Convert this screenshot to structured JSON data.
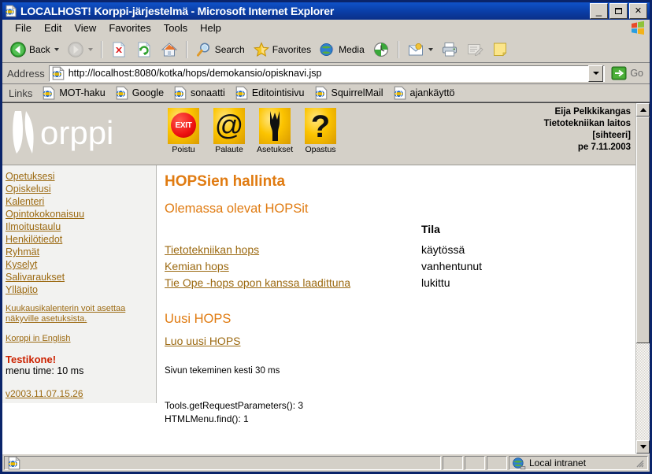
{
  "window": {
    "title": "LOCALHOST! Korppi-järjestelmä - Microsoft Internet Explorer",
    "icon": "ie-page-icon",
    "minimize_label": "_",
    "maximize_label": "",
    "close_label": "✕"
  },
  "menubar": {
    "items": [
      {
        "label": "File",
        "name": "menu-file"
      },
      {
        "label": "Edit",
        "name": "menu-edit"
      },
      {
        "label": "View",
        "name": "menu-view"
      },
      {
        "label": "Favorites",
        "name": "menu-favorites"
      },
      {
        "label": "Tools",
        "name": "menu-tools"
      },
      {
        "label": "Help",
        "name": "menu-help"
      }
    ]
  },
  "toolbar": {
    "back_label": "Back",
    "search_label": "Search",
    "favorites_label": "Favorites",
    "media_label": "Media"
  },
  "address": {
    "label": "Address",
    "url": "http://localhost:8080/kotka/hops/demokansio/opisknavi.jsp",
    "placeholder": "",
    "go_label": "Go"
  },
  "links": {
    "label": "Links",
    "items": [
      {
        "label": "MOT-haku"
      },
      {
        "label": "Google"
      },
      {
        "label": "sonaatti"
      },
      {
        "label": "Editointisivu"
      },
      {
        "label": "SquirrelMail"
      },
      {
        "label": "ajankäyttö"
      }
    ]
  },
  "korppi": {
    "logo_text": "Korppi",
    "icons": [
      {
        "label": "Poistu",
        "glyph": "EXIT",
        "icon": "exit-icon"
      },
      {
        "label": "Palaute",
        "glyph": "@",
        "icon": "at-icon"
      },
      {
        "label": "Asetukset",
        "glyph": "wrench",
        "icon": "wrench-icon"
      },
      {
        "label": "Opastus",
        "glyph": "?",
        "icon": "question-icon"
      }
    ],
    "user": {
      "name": "Eija Pelkkikangas",
      "department": "Tietotekniikan laitos",
      "role": "[sihteeri]",
      "date": "pe 7.11.2003"
    }
  },
  "sidebar": {
    "items": [
      {
        "label": "Opetuksesi"
      },
      {
        "label": "Opiskelusi"
      },
      {
        "label": "Kalenteri"
      },
      {
        "label": "Opintokokonaisuu"
      },
      {
        "label": "Ilmoitustaulu"
      },
      {
        "label": "Henkilötiedot"
      },
      {
        "label": "Ryhmät"
      },
      {
        "label": "Kyselyt"
      },
      {
        "label": "Salivaraukset"
      },
      {
        "label": "Ylläpito"
      }
    ],
    "note": "Kuukausikalenterin voit asettaa näkyville asetuksista.",
    "english_link": "Korppi in English",
    "test_machine": "Testikone!",
    "menu_time": "menu time: 10 ms",
    "version": "v2003.11.07.15.26"
  },
  "main": {
    "page_title": "HOPSien hallinta",
    "existing_heading": "Olemassa olevat HOPSit",
    "state_header": "Tila",
    "hops_rows": [
      {
        "name": "Tietotekniikan hops",
        "state": "käytössä"
      },
      {
        "name": "Kemian hops",
        "state": "vanhentunut"
      },
      {
        "name": "Tie Ope -hops opon kanssa laadittuna",
        "state": "lukittu"
      }
    ],
    "new_heading": "Uusi HOPS",
    "new_link": "Luo uusi HOPS",
    "timing": "Sivun tekeminen kesti 30 ms",
    "debug_lines": [
      "Tools.getRequestParameters(): 3",
      "HTMLMenu.find(): 1"
    ]
  },
  "statusbar": {
    "message": "",
    "zone": "Local intranet"
  },
  "colors": {
    "accent_orange": "#e07b11",
    "link_brown": "#9c6a12",
    "alert_red": "#cc2200",
    "titlebar_blue": "#0a3fa8",
    "chrome_gray": "#d4d0c8"
  }
}
